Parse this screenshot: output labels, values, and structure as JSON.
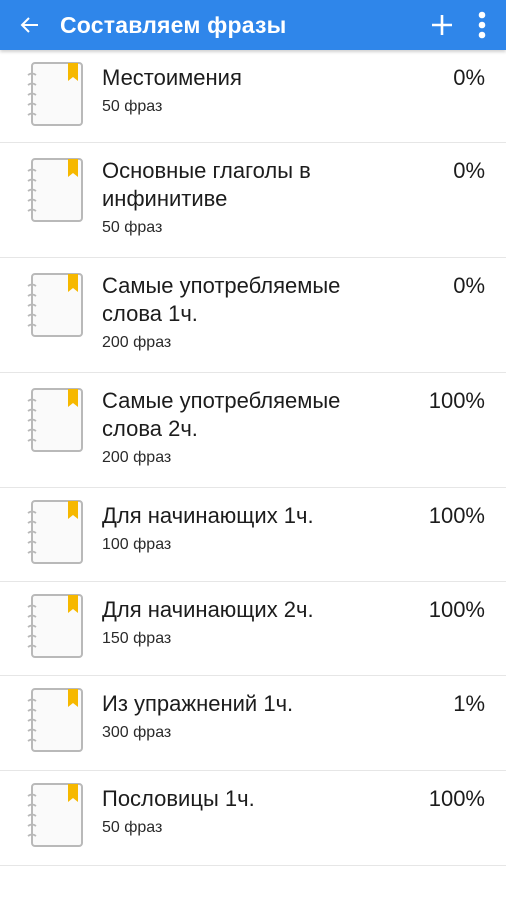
{
  "appbar": {
    "title": "Составляем фразы",
    "color": "#2f86ea"
  },
  "items": [
    {
      "name": "Местоимения",
      "count": "50 фраз",
      "percent": "0%"
    },
    {
      "name": "Основные глаголы в инфинитиве",
      "count": "50 фраз",
      "percent": "0%"
    },
    {
      "name": "Самые употребляемые слова 1ч.",
      "count": "200 фраз",
      "percent": "0%"
    },
    {
      "name": "Самые употребляемые слова 2ч.",
      "count": "200 фраз",
      "percent": "100%"
    },
    {
      "name": "Для начинающих 1ч.",
      "count": "100 фраз",
      "percent": "100%"
    },
    {
      "name": "Для начинающих 2ч.",
      "count": "150 фраз",
      "percent": "100%"
    },
    {
      "name": "Из упражнений 1ч.",
      "count": "300 фраз",
      "percent": "1%"
    },
    {
      "name": "Пословицы 1ч.",
      "count": "50 фраз",
      "percent": "100%"
    }
  ],
  "icons": {
    "back": "arrow-back-icon",
    "add": "plus-icon",
    "more": "more-vertical-icon",
    "item": "notebook-bookmark-icon"
  },
  "bookmark_color": "#f6b800"
}
